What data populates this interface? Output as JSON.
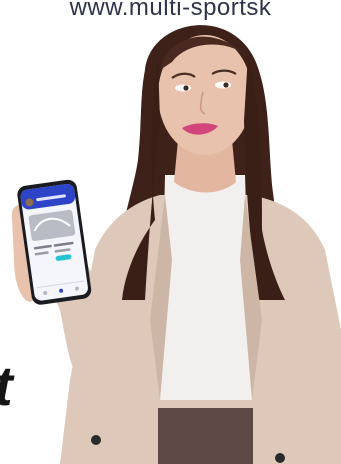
{
  "banner": {
    "url_text": "www.multi-sportsk"
  },
  "headline": {
    "visible_letter": "t"
  },
  "phone": {
    "app_header": "",
    "card_status_color": "#27c4d8",
    "header_color": "#2d44c9"
  },
  "colors": {
    "hair": "#3e2219",
    "skin": "#e8c2ac",
    "blazer": "#ddc8b9",
    "top": "#f2f0ee",
    "lips": "#d2457b"
  }
}
